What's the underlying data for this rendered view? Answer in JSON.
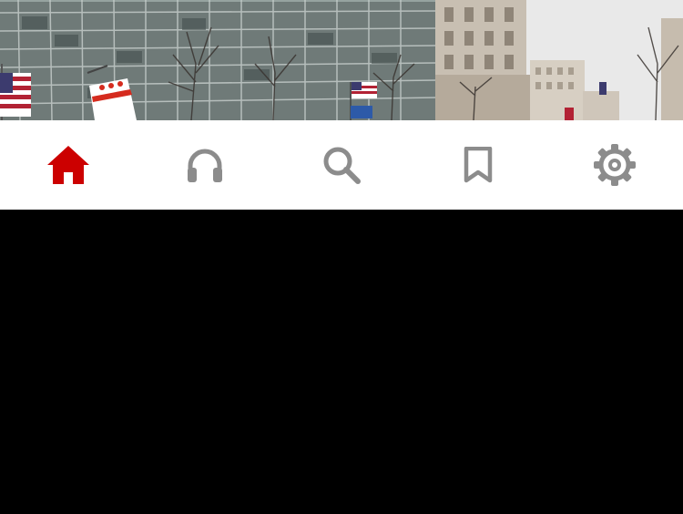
{
  "hero": {
    "image": "street-buildings-flags-photo"
  },
  "tabbar": {
    "active_color": "#cc0000",
    "inactive_color": "#8c8c8c",
    "tabs": [
      {
        "icon": "home-icon",
        "active": true
      },
      {
        "icon": "headphones-icon",
        "active": false
      },
      {
        "icon": "search-icon",
        "active": false
      },
      {
        "icon": "bookmark-icon",
        "active": false
      },
      {
        "icon": "gear-icon",
        "active": false
      }
    ]
  }
}
